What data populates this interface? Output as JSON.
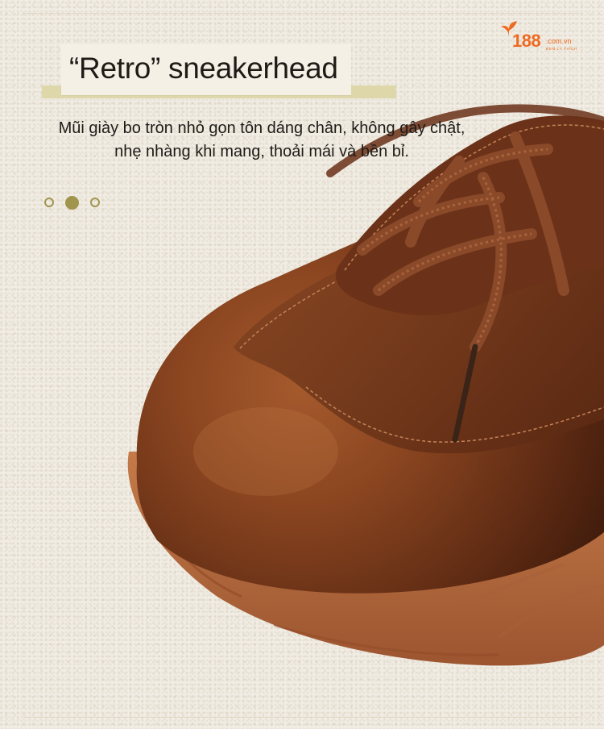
{
  "brand": {
    "name": "188",
    "tld": ".com.vn",
    "slogan": "ĐEM LÀ THÍCH",
    "color": "#ef6a21"
  },
  "title": "“Retro” sneakerhead",
  "subtitle_lines": [
    "Mũi giày bo tròn nhỏ gọn tôn dáng chân, không gây chật,",
    "nhẹ nhàng khi mang, thoải mái và bền bỉ."
  ],
  "carousel": {
    "total": 3,
    "active_index": 2
  },
  "colors": {
    "accent": "#a1954d",
    "leather": "#7a3c1c",
    "sole": "#b76b3d",
    "background": "#f1ede4"
  }
}
